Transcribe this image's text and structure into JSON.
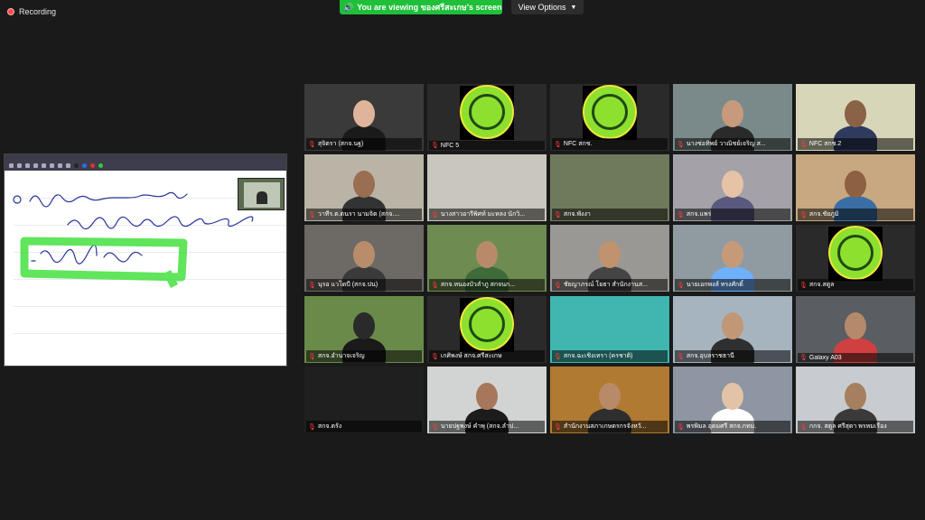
{
  "top": {
    "recording_label": "Recording",
    "banner_text": "You are viewing ของศรีสะเกษ's screen",
    "view_options_label": "View Options"
  },
  "colors": {
    "banner_green": "#1fbf3a",
    "active_speaker_outline": "#d6f000",
    "mic_muted": "#ff3b3b",
    "logo_green": "#8ee02e"
  },
  "participants": [
    {
      "name": "สุจิตรา (สกจ.นฐ)",
      "muted": true
    },
    {
      "name": "NFC 5",
      "muted": true
    },
    {
      "name": "NFC สกช.",
      "muted": true
    },
    {
      "name": "นางช่อทิพย์ วาณิชย์เจริญ ส...",
      "muted": true
    },
    {
      "name": "NFC สกช.2",
      "muted": true
    },
    {
      "name": "วาทีร.ต.ตนรา นามจิต (สกจ....",
      "muted": true
    },
    {
      "name": "นางสาวอารีพิศท์ มะหลง นักวิ...",
      "muted": true
    },
    {
      "name": "สกจ.พังงา",
      "muted": true
    },
    {
      "name": "สกจ.แพร่",
      "muted": true
    },
    {
      "name": "สกจ.ชัยภูมิ",
      "muted": true
    },
    {
      "name": "นุรอ แวโดบี (สกจ.ปน)",
      "muted": true
    },
    {
      "name": "สกจ.หนองบัวลำภู สกจนก...",
      "muted": true
    },
    {
      "name": "ชัยญาภรณ์ โยธา สำนักงานส...",
      "muted": true
    },
    {
      "name": "นายเอกพงส์ ทรงศักดิ์",
      "muted": true
    },
    {
      "name": "สกจ.สตูล",
      "muted": true
    },
    {
      "name": "สกจ.อำนาจเจริญ",
      "muted": true
    },
    {
      "name": "เกศิพงษ์ สกจ.ศรีสะเกษ",
      "muted": true
    },
    {
      "name": "สกจ.ฉะเชิงเทรา (ครชาติ)",
      "muted": true
    },
    {
      "name": "สกจ.อุบลราชธานี",
      "muted": true
    },
    {
      "name": "Galaxy A03",
      "muted": true
    },
    {
      "name": "สกจ.ตรัง",
      "muted": true
    },
    {
      "name": "นายปฐพงษ์ คำพุ (สกจ.ลำป...",
      "muted": true
    },
    {
      "name": "สำนักงานสภาเกษตรกรจังหวั...",
      "muted": true
    },
    {
      "name": "พรพิมล อุดมศรี สกจ.กทม.",
      "muted": true
    },
    {
      "name": "กกจ. สตูล ศรีสุดา พรหมเรือง",
      "muted": true
    }
  ]
}
